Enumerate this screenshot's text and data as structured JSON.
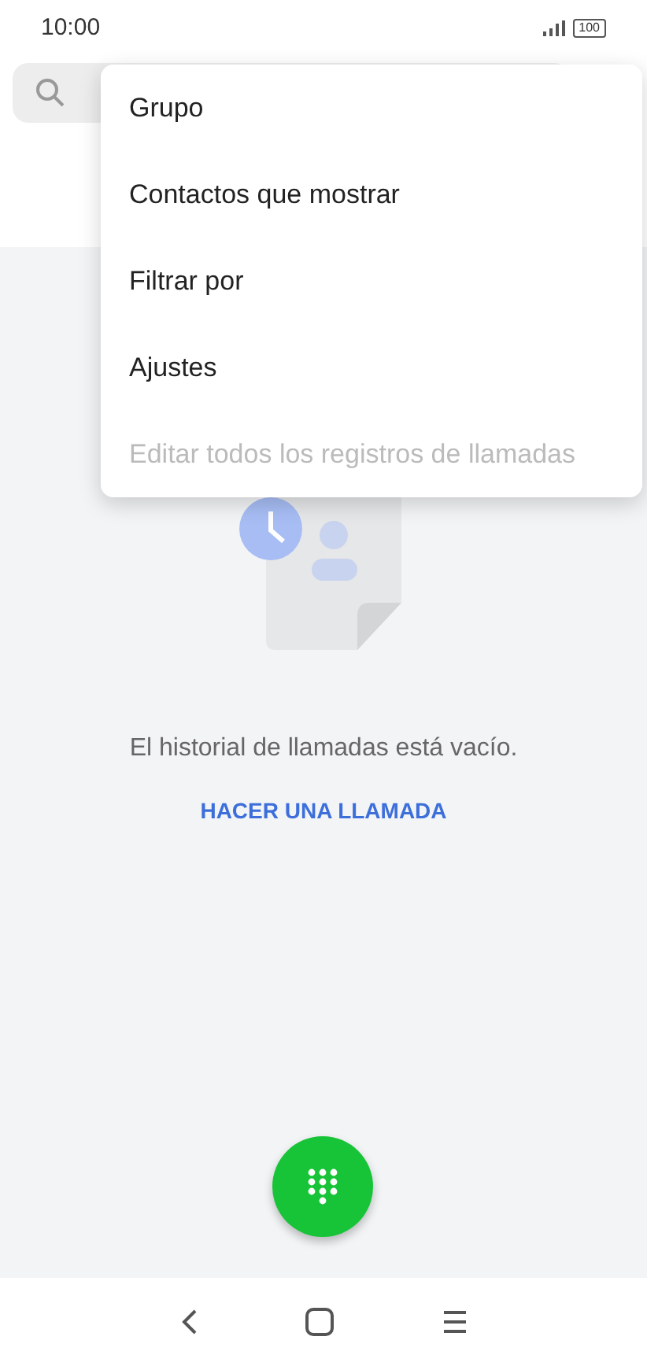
{
  "status_bar": {
    "time": "10:00",
    "battery": "100"
  },
  "menu": [
    {
      "label": "Grupo",
      "disabled": false
    },
    {
      "label": "Contactos que mostrar",
      "disabled": false
    },
    {
      "label": "Filtrar por",
      "disabled": false
    },
    {
      "label": "Ajustes",
      "disabled": false
    },
    {
      "label": "Editar todos los registros de llamadas",
      "disabled": true
    }
  ],
  "empty_state": {
    "message": "El historial de llamadas está vacío.",
    "action": "HACER UNA LLAMADA"
  }
}
